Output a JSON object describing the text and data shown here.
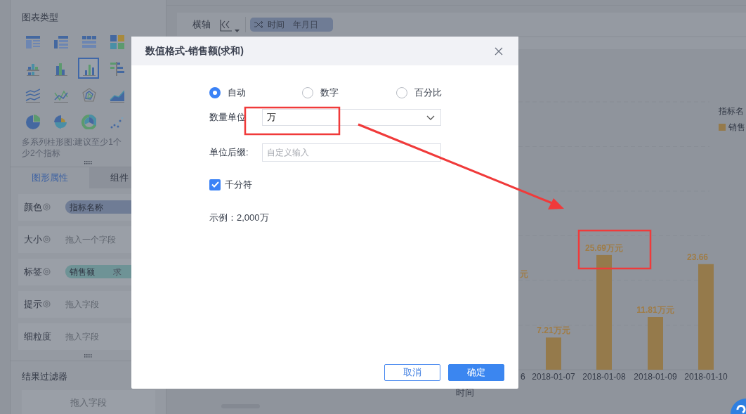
{
  "chart_types_panel": {
    "title": "图表类型",
    "types": [
      {
        "kind": "table",
        "selected": false
      },
      {
        "kind": "cross-table",
        "selected": false
      },
      {
        "kind": "grid-table",
        "selected": false
      },
      {
        "kind": "heat-grid",
        "selected": false
      },
      {
        "kind": "stacked-bar",
        "selected": false
      },
      {
        "kind": "grouped-bar",
        "selected": false
      },
      {
        "kind": "multi-bar",
        "selected": true
      },
      {
        "kind": "horizontal-bar",
        "selected": false
      },
      {
        "kind": "multi-line",
        "selected": false
      },
      {
        "kind": "line",
        "selected": false
      },
      {
        "kind": "radar",
        "selected": false
      },
      {
        "kind": "area",
        "selected": false
      },
      {
        "kind": "pie",
        "selected": false
      },
      {
        "kind": "rose",
        "selected": false
      },
      {
        "kind": "donut",
        "selected": false
      },
      {
        "kind": "scatter",
        "selected": false
      }
    ],
    "hint_lines": [
      "多系列柱形图:建议至少1个",
      "少2个指标"
    ]
  },
  "property_tabs": [
    {
      "label": "图形属性",
      "selected": true
    },
    {
      "label": "组件",
      "selected": false
    }
  ],
  "property_rows": [
    {
      "label": "颜色",
      "settings_icon": true,
      "field": {
        "kind": "pill",
        "text": "指标名称",
        "color": "#6f7c95"
      }
    },
    {
      "label": "大小",
      "settings_icon": true,
      "field": {
        "kind": "hint",
        "text": "拖入一个字段"
      }
    },
    {
      "label": "标签",
      "settings_icon": true,
      "field": {
        "kind": "pill",
        "text": "销售额",
        "suffix": "求",
        "color": "#6e9396"
      }
    },
    {
      "label": "提示",
      "settings_icon": true,
      "field": {
        "kind": "hint",
        "text": "拖入字段"
      }
    },
    {
      "label": "细粒度",
      "settings_icon": false,
      "field": {
        "kind": "hint",
        "text": "拖入字段"
      }
    }
  ],
  "result_filter": {
    "title": "结果过滤器",
    "hint": "拖入字段"
  },
  "axis_bar": {
    "label": "横轴",
    "field": {
      "name": "时间",
      "granularity": "年月日"
    }
  },
  "chart": {
    "chart_data": {
      "type": "bar",
      "categories": [
        "2018-01-07",
        "2018-01-08",
        "2018-01-09",
        "2018-01-10"
      ],
      "series": [
        {
          "name": "销售",
          "color": "#957a4b",
          "values": [
            7.21,
            25.69,
            11.81,
            23.66
          ]
        }
      ],
      "data_labels": true
    },
    "label_units": [
      "万元",
      "万元",
      "万元"
    ],
    "axis_title": "时间",
    "partial_category_label": "6",
    "partial_value_label": "元",
    "legend": {
      "title": "指标名"
    }
  },
  "dialog": {
    "title": "数值格式-销售额(求和)",
    "format_options": [
      {
        "label": "自动",
        "selected": true
      },
      {
        "label": "数字",
        "selected": false
      },
      {
        "label": "百分比",
        "selected": false
      }
    ],
    "unit": {
      "label": "数量单位",
      "value": "万"
    },
    "suffix": {
      "label": "单位后缀:",
      "placeholder": "自定义输入"
    },
    "thousands": {
      "label": "千分符",
      "checked": true
    },
    "example": "示例：2,000万",
    "buttons": [
      {
        "label": "取消",
        "kind": "secondary"
      },
      {
        "label": "确定",
        "kind": "primary"
      }
    ]
  },
  "annotations": [
    {
      "kind": "box"
    },
    {
      "kind": "box"
    },
    {
      "kind": "arrow"
    }
  ]
}
